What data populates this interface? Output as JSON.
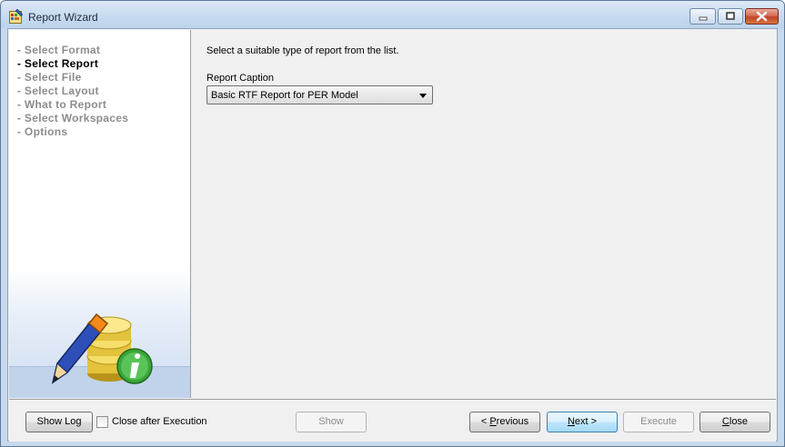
{
  "window": {
    "title": "Report Wizard"
  },
  "sidebar": {
    "steps": [
      {
        "label": "- Select Format",
        "active": false
      },
      {
        "label": "- Select Report",
        "active": true
      },
      {
        "label": "- Select File",
        "active": false
      },
      {
        "label": "- Select Layout",
        "active": false
      },
      {
        "label": "- What to Report",
        "active": false
      },
      {
        "label": "- Select Workspaces",
        "active": false
      },
      {
        "label": "- Options",
        "active": false
      }
    ]
  },
  "main": {
    "instruction": "Select a suitable type of report from the list.",
    "caption_label": "Report Caption",
    "caption_value": "Basic RTF Report for PER Model"
  },
  "footer": {
    "show_log": "Show Log",
    "close_after_execution": "Close after Execution",
    "close_after_execution_checked": false,
    "show": "Show",
    "previous": {
      "prefix": "< ",
      "mnemonic": "P",
      "rest": "revious"
    },
    "next": {
      "mnemonic": "N",
      "rest": "ext >"
    },
    "execute": "Execute",
    "close": {
      "mnemonic": "C",
      "rest": "lose"
    }
  },
  "icons": {
    "app": "report-wizard-app-icon",
    "sidebar_art": "pencil-database-info-icon"
  },
  "colors": {
    "accent": "#3c7fb1",
    "title_bar": "#c9dcf1",
    "inactive_step": "#8c8c8c"
  }
}
